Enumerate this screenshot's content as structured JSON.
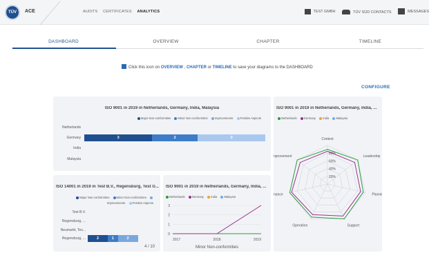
{
  "header": {
    "logo_text": "TÜV",
    "app_name": "ACE",
    "nav": [
      "AUDITS",
      "CERTIFICATES",
      "ANALYTICS"
    ],
    "right_items": [
      {
        "icon": "building-icon",
        "label": "TEST GMBH"
      },
      {
        "icon": "people-icon",
        "label": "TÜV SÜD CONTACTS"
      },
      {
        "icon": "message-icon",
        "label": "MESSAGES"
      }
    ]
  },
  "tabs": [
    "DASHBOARD",
    "OVERVIEW",
    "CHAPTER",
    "TIMELINE"
  ],
  "hint": {
    "pre": "Click this icon on ",
    "overview": "OVERVIEW",
    "sep1": " , ",
    "chapter": "CHAPTER",
    "or": " or ",
    "timeline": "TIMELINE",
    "post": " to save your diagrams to the DASHBOARD"
  },
  "configure": "CONFIGURE",
  "colors": {
    "brand": "#1f4f8f",
    "link": "#2a6ab5",
    "major": "#1f4f8f",
    "minor": "#3d7cc9",
    "improvements": "#7aa8de",
    "positive": "#a9c8ee",
    "netherlands": "#2e9a3f",
    "germany": "#9a2f8f",
    "india": "#f0a030",
    "malaysia": "#7aa8de"
  },
  "card1": {
    "title": "ISO 9001 in 2019 in Netherlands, Germany, India, Malaysia",
    "legend": [
      "Major Non-conformities",
      "Minor Non-conformities",
      "Improvements",
      "Positive Aspects"
    ],
    "chart_data": {
      "type": "bar",
      "orientation": "horizontal",
      "stacked": true,
      "categories": [
        "Netherlands",
        "Germany",
        "India",
        "Malaysia"
      ],
      "series": [
        {
          "name": "Major Non-conformities",
          "values": [
            0,
            3,
            0,
            0
          ]
        },
        {
          "name": "Minor Non-conformities",
          "values": [
            0,
            2,
            0,
            0
          ]
        },
        {
          "name": "Improvements",
          "values": [
            0,
            0,
            0,
            0
          ]
        },
        {
          "name": "Positive Aspects",
          "values": [
            0,
            3,
            0,
            0
          ]
        }
      ]
    }
  },
  "card2": {
    "title": "ISO 9001 in 2019 in Netherlands, Germany, India, ...",
    "legend": [
      "Netherlands",
      "Germany",
      "India",
      "Malaysia"
    ],
    "chart_data": {
      "type": "radar",
      "axes": [
        "Context",
        "Leadership",
        "Planning",
        "Support",
        "Operation",
        "Performance",
        "Improvement"
      ],
      "ticks": [
        "20%",
        "40%",
        "60%",
        "80%"
      ],
      "series": [
        {
          "name": "Netherlands",
          "values": [
            90,
            100,
            95,
            100,
            95,
            100,
            100
          ]
        },
        {
          "name": "Germany",
          "values": [
            85,
            90,
            88,
            92,
            88,
            95,
            90
          ]
        }
      ]
    }
  },
  "card3": {
    "title": "ISO 14001 in 2019 in Test B.V., Regensburg, Test G...",
    "legend": [
      "Major Non-conformities",
      "Minor Non-conformities",
      "Improvements",
      "Positive Aspects"
    ],
    "pager": "4 / 10",
    "chart_data": {
      "type": "bar",
      "orientation": "horizontal",
      "stacked": true,
      "categories": [
        "Test B.V.",
        "Regensburg, ...",
        "Neumarkt, Tes...",
        "Regensburg, ..."
      ],
      "series": [
        {
          "name": "Major Non-conformities",
          "values": [
            0,
            0,
            0,
            2
          ]
        },
        {
          "name": "Minor Non-conformities",
          "values": [
            0,
            0,
            0,
            1
          ]
        },
        {
          "name": "Improvements",
          "values": [
            0,
            0,
            0,
            2
          ]
        },
        {
          "name": "Positive Aspects",
          "values": [
            0,
            0,
            0,
            0
          ]
        }
      ]
    }
  },
  "card4": {
    "title": "ISO 9001 in 2019 in Netherlands, Germany, India, ...",
    "legend": [
      "Netherlands",
      "Germany",
      "India",
      "Malaysia"
    ],
    "xlabel": "Minor Non-conformities",
    "chart_data": {
      "type": "line",
      "x": [
        2017,
        2018,
        2019
      ],
      "y_ticks": [
        0,
        1,
        2,
        3
      ],
      "ylim": [
        0,
        3
      ],
      "series": [
        {
          "name": "Netherlands",
          "values": [
            0,
            0,
            0
          ]
        },
        {
          "name": "Germany",
          "values": [
            0,
            0,
            3
          ]
        }
      ]
    }
  }
}
